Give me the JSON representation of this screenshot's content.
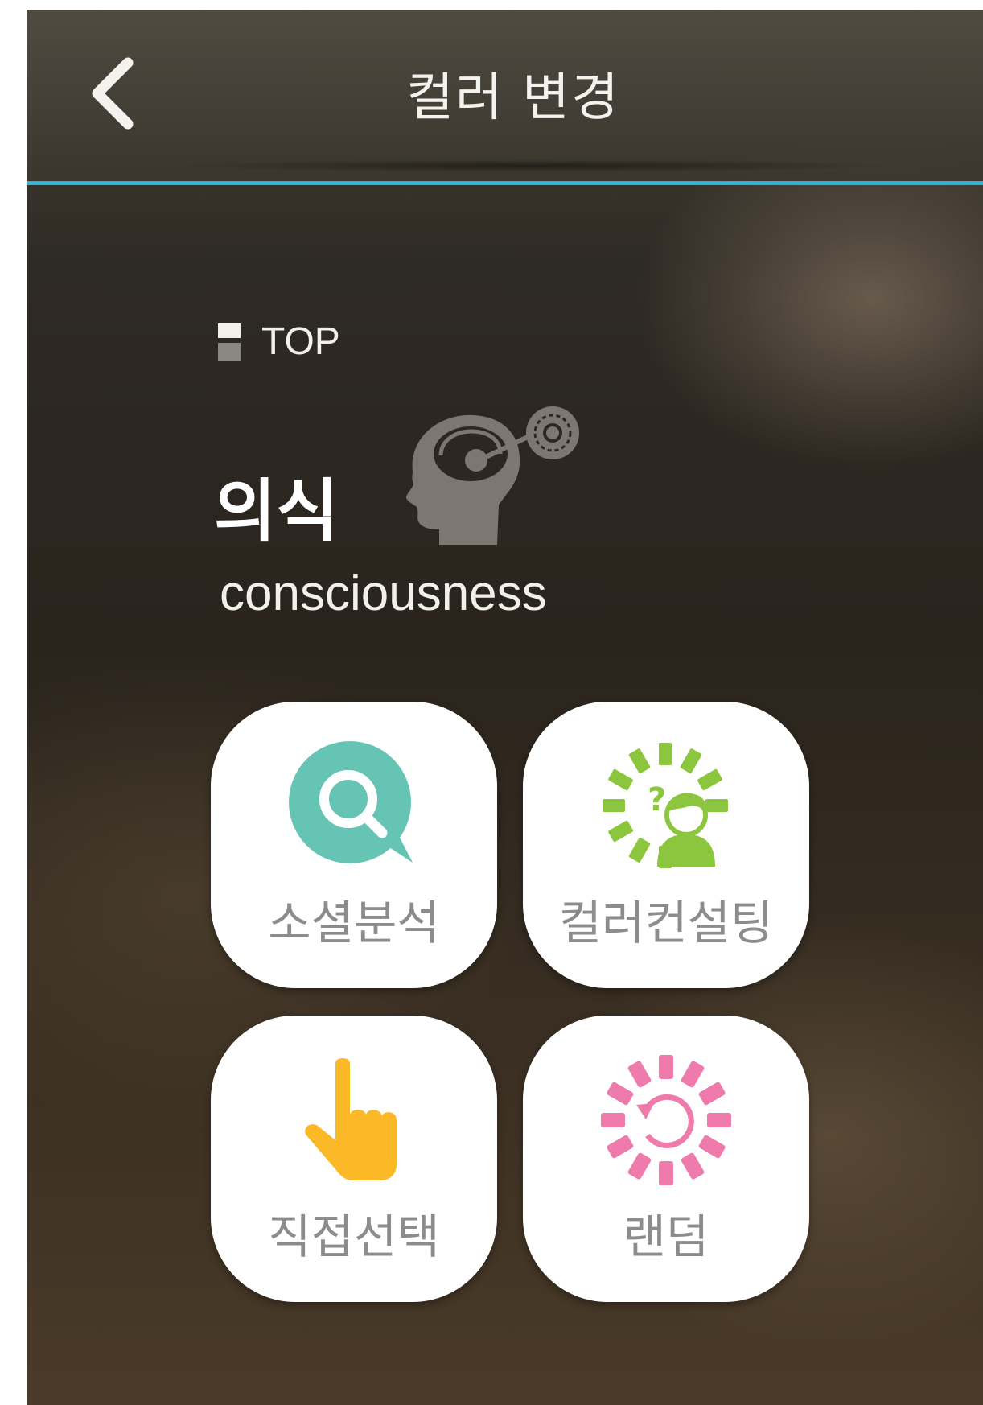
{
  "header": {
    "title": "컬러 변경",
    "back_icon": "chevron-left-icon",
    "accent_color": "#2ab3d6"
  },
  "current": {
    "rank_label": "TOP",
    "name_ko": "의식",
    "name_en": "consciousness",
    "icon": "head-with-gear-icon"
  },
  "menu": [
    {
      "label": "소셜분석",
      "icon": "search-bubble-icon",
      "color": "#66c4b4"
    },
    {
      "label": "컬러컨설팅",
      "icon": "person-question-icon",
      "color": "#8cc63f"
    },
    {
      "label": "직접선택",
      "icon": "pointing-hand-icon",
      "color": "#fbb927"
    },
    {
      "label": "랜덤",
      "icon": "random-circle-icon",
      "color": "#ee7bab"
    }
  ]
}
